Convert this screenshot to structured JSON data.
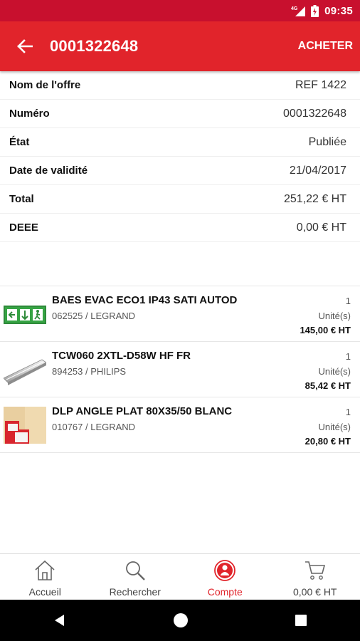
{
  "status_bar": {
    "network": "4G",
    "time": "09:35"
  },
  "app_bar": {
    "title": "0001322648",
    "action": "ACHETER"
  },
  "details": [
    {
      "label": "Nom de l'offre",
      "value": "REF 1422"
    },
    {
      "label": "Numéro",
      "value": "0001322648"
    },
    {
      "label": "État",
      "value": "Publiée"
    },
    {
      "label": "Date de validité",
      "value": "21/04/2017"
    },
    {
      "label": "Total",
      "value": "251,22 € HT"
    },
    {
      "label": "DEEE",
      "value": "0,00 € HT"
    }
  ],
  "items": [
    {
      "name": "BAES EVAC ECO1 IP43 SATI AUTOD",
      "ref": "062525 / LEGRAND",
      "qty": "1",
      "unit": "Unité(s)",
      "price": "145,00 € HT",
      "thumb": "exit-sign-image"
    },
    {
      "name": "TCW060 2XTL-D58W HF FR",
      "ref": "894253 / PHILIPS",
      "qty": "1",
      "unit": "Unité(s)",
      "price": "85,42 € HT",
      "thumb": "tube-light-image"
    },
    {
      "name": "DLP ANGLE PLAT 80X35/50 BLANC",
      "ref": "010767 / LEGRAND",
      "qty": "1",
      "unit": "Unité(s)",
      "price": "20,80 € HT",
      "thumb": "cable-trunking-angle-image"
    }
  ],
  "bottom_nav": [
    {
      "label": "Accueil",
      "icon": "home-icon"
    },
    {
      "label": "Rechercher",
      "icon": "search-icon"
    },
    {
      "label": "Compte",
      "icon": "account-icon",
      "active": true
    },
    {
      "label": "0,00 € HT",
      "icon": "cart-icon"
    }
  ],
  "colors": {
    "primary": "#e1242b",
    "status_bar": "#c8102e"
  }
}
